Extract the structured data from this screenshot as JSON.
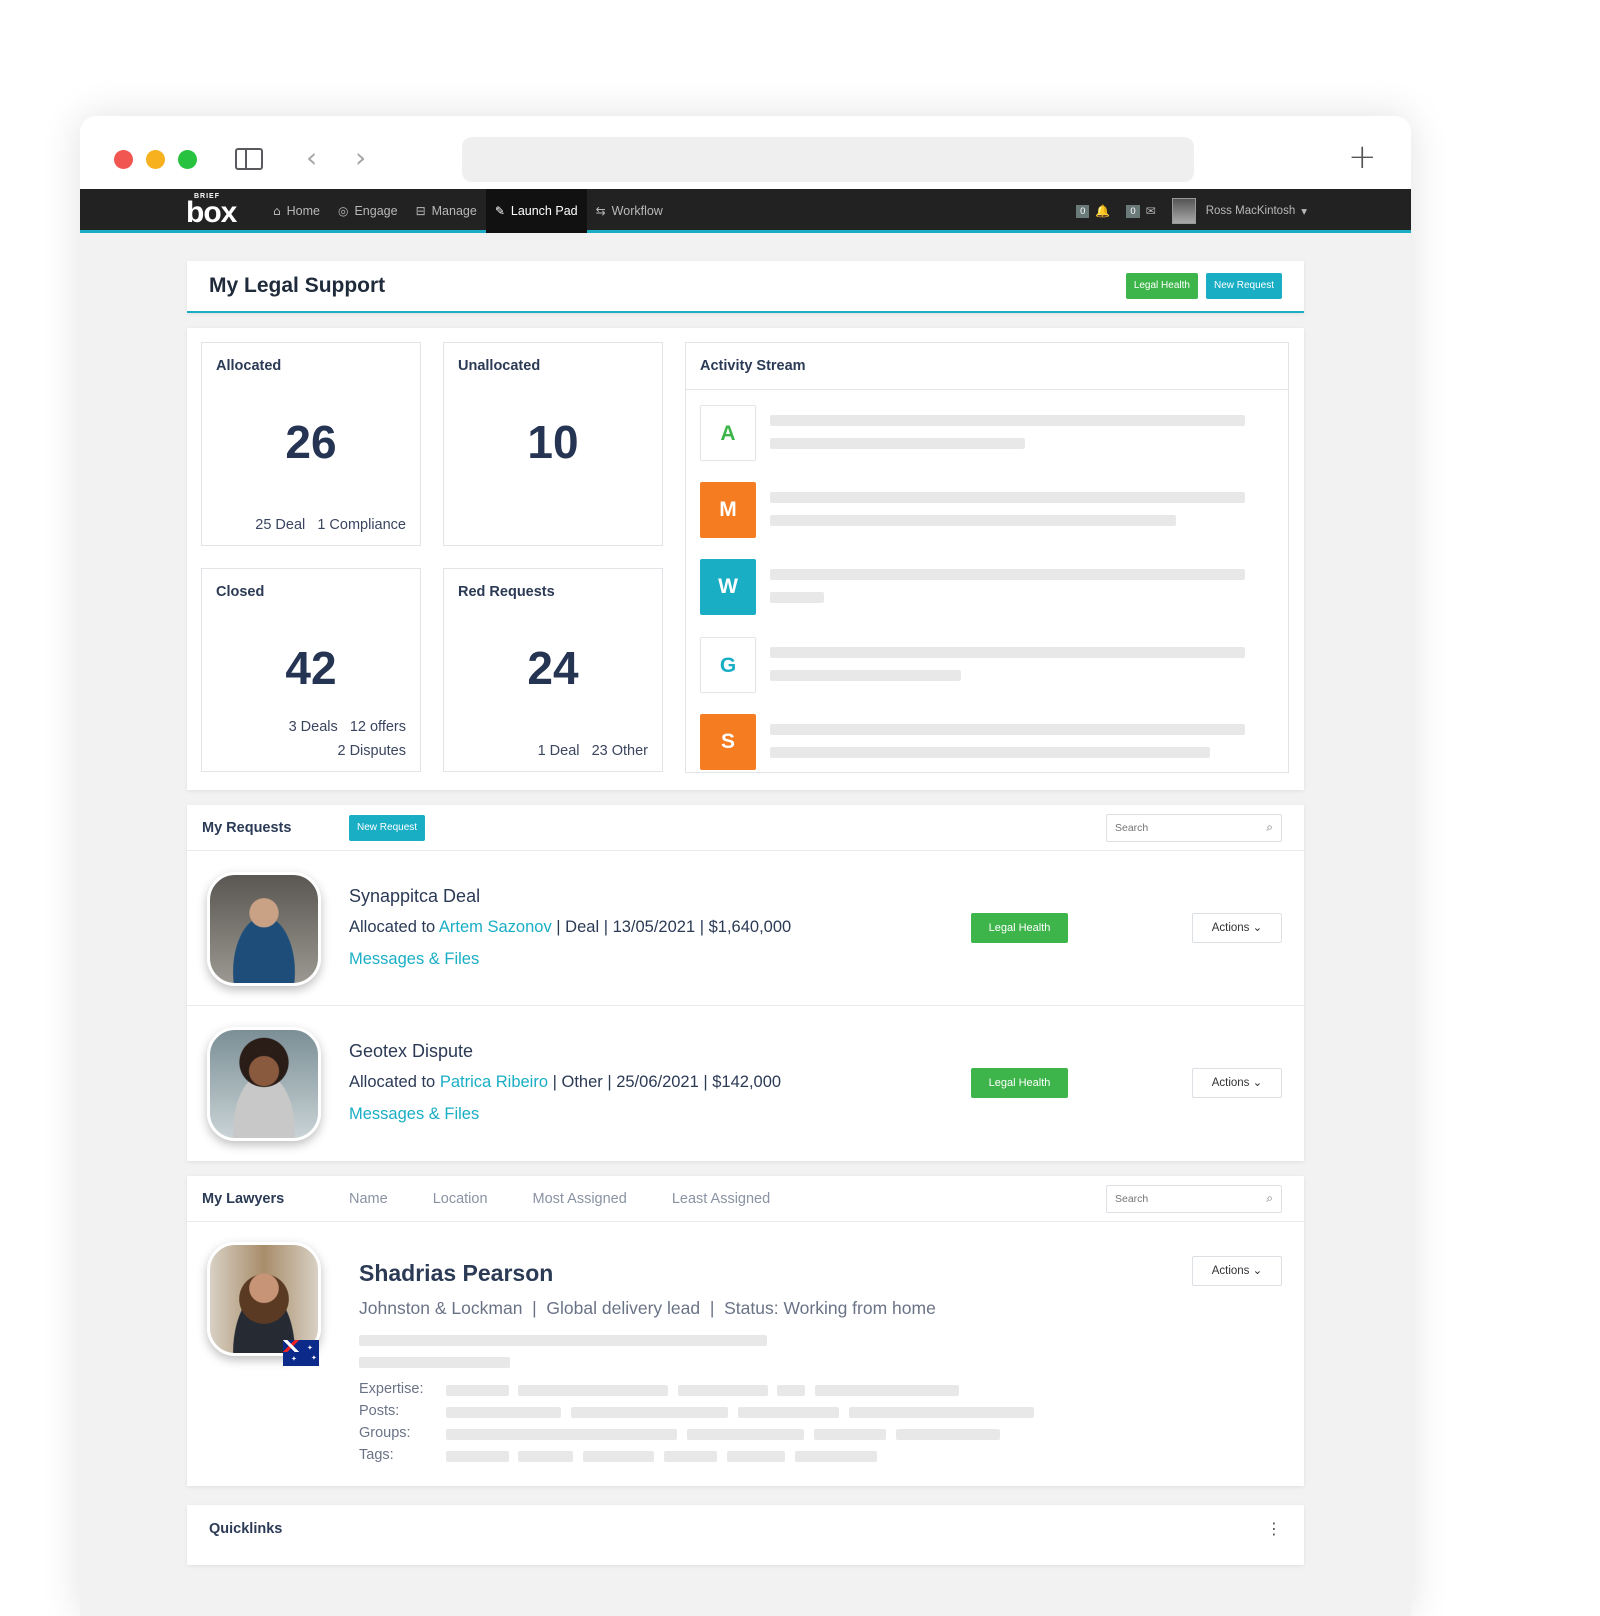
{
  "browser": {
    "back_icon": "‹",
    "forward_icon": "›",
    "new_tab_icon": "+"
  },
  "appbar": {
    "logo_top": "BRIEF",
    "logo_main": "box",
    "menu": [
      {
        "label": "Home",
        "icon": "⌂"
      },
      {
        "label": "Engage",
        "icon": "◎"
      },
      {
        "label": "Manage",
        "icon": "⊟"
      },
      {
        "label": "Launch Pad",
        "icon": "✎"
      },
      {
        "label": "Workflow",
        "icon": "⇆"
      }
    ],
    "notifications_count": "0",
    "notifications_icon": "🔔",
    "messages_count": "0",
    "messages_icon": "✉",
    "user_name": "Ross MacKintosh",
    "user_caret": "▾"
  },
  "header": {
    "title": "My Legal Support",
    "legal_health_label": "Legal Health",
    "new_request_label": "New Request"
  },
  "stats": {
    "allocated": {
      "label": "Allocated",
      "value": "26",
      "breakdown": "25 Deal   1 Compliance"
    },
    "unallocated": {
      "label": "Unallocated",
      "value": "10"
    },
    "closed": {
      "label": "Closed",
      "value": "42",
      "breakdown_1": "3 Deals   12 offers",
      "breakdown_2": "2 Disputes"
    },
    "red_requests": {
      "label": "Red Requests",
      "value": "24",
      "breakdown": "1 Deal   23 Other"
    }
  },
  "activity": {
    "title": "Activity Stream",
    "items": [
      {
        "initial": "A",
        "color": "#3db54a",
        "style": "outline"
      },
      {
        "initial": "M",
        "color": "#f57c20",
        "style": "filled"
      },
      {
        "initial": "W",
        "color": "#1aaec5",
        "style": "filled"
      },
      {
        "initial": "G",
        "color": "#1aaec5",
        "style": "outline"
      },
      {
        "initial": "S",
        "color": "#f57c20",
        "style": "filled"
      }
    ]
  },
  "requests": {
    "title": "My Requests",
    "new_request_label": "New Request",
    "search_placeholder": "Search",
    "items": [
      {
        "name": "Synappitca Deal",
        "allocated_prefix": "Allocated to ",
        "lawyer": "Artem Sazonov",
        "details": " | Deal | 13/05/2021 | $1,640,000",
        "files_link": "Messages & Files",
        "legal_health_label": "Legal Health",
        "actions_label": "Actions"
      },
      {
        "name": "Geotex Dispute",
        "allocated_prefix": "Allocated to ",
        "lawyer": "Patrica Ribeiro",
        "details": " | Other | 25/06/2021 | $142,000",
        "files_link": "Messages & Files",
        "legal_health_label": "Legal Health",
        "actions_label": "Actions"
      }
    ]
  },
  "lawyers": {
    "title": "My Lawyers",
    "tabs": [
      "Name",
      "Location",
      "Most Assigned",
      "Least Assigned"
    ],
    "search_placeholder": "Search",
    "item": {
      "name": "Shadrias Pearson",
      "info": "Johnston & Lockman  |  Global delivery lead  |  Status: Working from home",
      "actions_label": "Actions",
      "labels": [
        "Expertise:",
        "Posts:",
        "Groups:",
        "Tags:"
      ]
    }
  },
  "quicklinks": {
    "title": "Quicklinks",
    "menu_icon": "⋮"
  },
  "actions_caret": "⌄",
  "search_icon": "⌕"
}
